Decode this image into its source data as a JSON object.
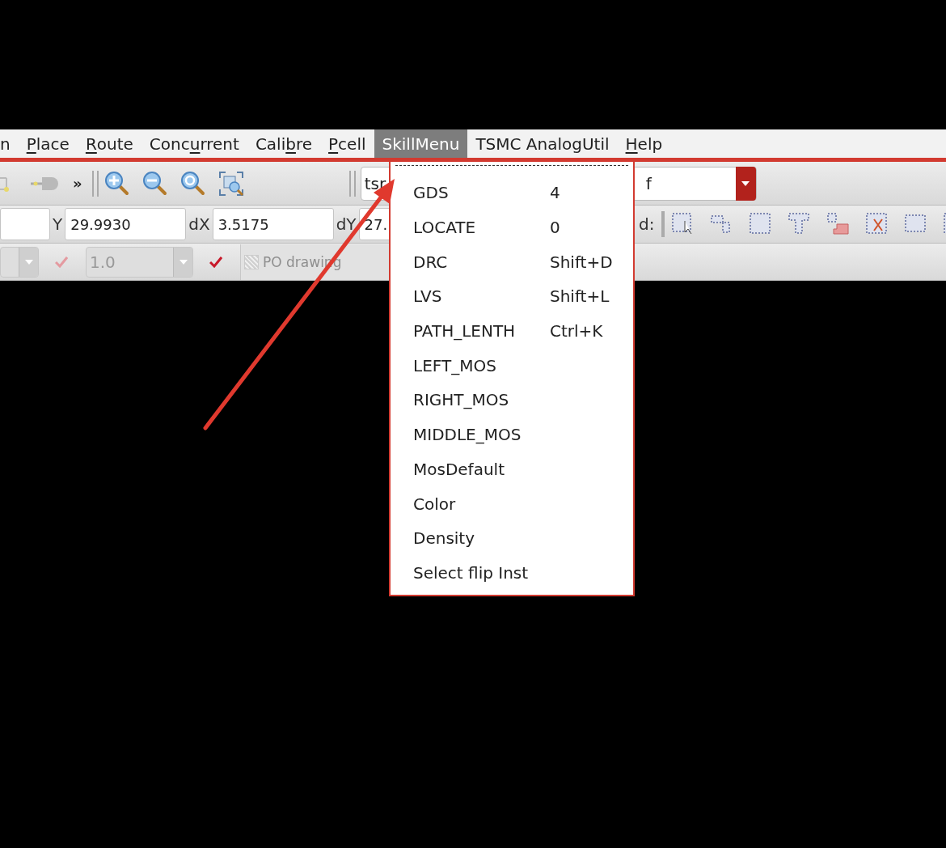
{
  "menubar": [
    {
      "label_before": "n",
      "selected": false
    },
    {
      "mnemonic": "P",
      "label_after": "lace",
      "selected": false
    },
    {
      "mnemonic": "R",
      "label_after": "oute",
      "selected": false
    },
    {
      "label_before": "Conc",
      "mnemonic": "u",
      "label_after": "rrent",
      "selected": false
    },
    {
      "label_before": "Cali",
      "mnemonic": "b",
      "label_after": "re",
      "selected": false
    },
    {
      "mnemonic": "P",
      "label_after": "cell",
      "selected": false
    },
    {
      "label_before": "SkillMenu",
      "selected": true
    },
    {
      "label_before": "TSMC AnalogUtil",
      "selected": false
    },
    {
      "mnemonic": "H",
      "label_after": "elp",
      "selected": false
    }
  ],
  "toolbar": {
    "overflow": "»",
    "layer_combo": {
      "value": "tsr",
      "value_tail": "f"
    }
  },
  "coordinates": {
    "fields": [
      {
        "label": "Y",
        "value": "29.9930"
      },
      {
        "label": "dX",
        "value": "3.5175"
      },
      {
        "label": "dY",
        "value": "27."
      }
    ],
    "snap_label": "d:"
  },
  "options_row": [
    {
      "kind": "combo",
      "disabled": true
    },
    {
      "kind": "check",
      "checked": true,
      "disabled": true
    },
    {
      "kind": "combo",
      "value": "1.0",
      "disabled": true
    },
    {
      "kind": "check",
      "checked": true,
      "disabled": false
    },
    {
      "kind": "layer",
      "label": "PO drawing",
      "disabled": true
    }
  ],
  "skill_menu": {
    "tear_off": true,
    "items": [
      {
        "label": "GDS",
        "shortcut": "4"
      },
      {
        "label": "LOCATE",
        "shortcut": "0"
      },
      {
        "label": "DRC",
        "shortcut": "Shift+D"
      },
      {
        "label": "LVS",
        "shortcut": "Shift+L"
      },
      {
        "label": "PATH_LENTH",
        "shortcut": "Ctrl+K"
      },
      {
        "label": "LEFT_MOS"
      },
      {
        "label": "RIGHT_MOS"
      },
      {
        "label": "MIDDLE_MOS"
      },
      {
        "label": "MosDefault"
      },
      {
        "label": "Color"
      },
      {
        "label": "Density"
      },
      {
        "label": "Select flip Inst"
      }
    ]
  }
}
